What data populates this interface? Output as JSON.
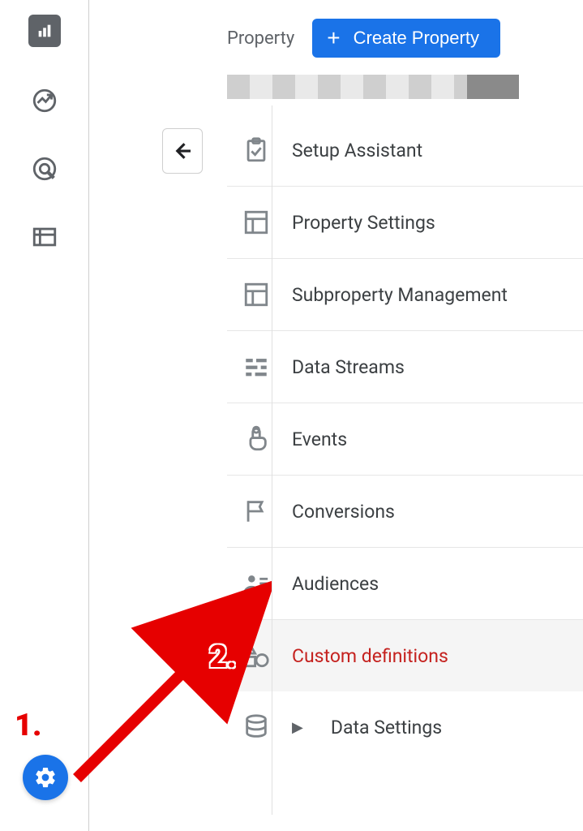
{
  "header": {
    "section_label": "Property",
    "create_button": "Create Property"
  },
  "menu": {
    "setup_assistant": "Setup Assistant",
    "property_settings": "Property Settings",
    "subproperty_management": "Subproperty Management",
    "data_streams": "Data Streams",
    "events": "Events",
    "conversions": "Conversions",
    "audiences": "Audiences",
    "custom_definitions": "Custom definitions",
    "data_settings": "Data Settings"
  },
  "annotations": {
    "one": "1.",
    "two": "2."
  }
}
